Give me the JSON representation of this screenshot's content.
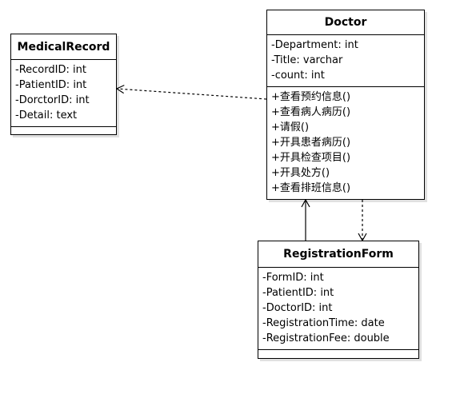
{
  "colors": {
    "line": "#000000",
    "background": "#ffffff"
  },
  "classes": {
    "medical_record": {
      "name": "MedicalRecord",
      "attributes": [
        "-RecordID: int",
        "-PatientID: int",
        "-DorctorID: int",
        "-Detail: text"
      ],
      "operations": []
    },
    "doctor": {
      "name": "Doctor",
      "attributes": [
        "-Department: int",
        "-Title: varchar",
        "-count: int"
      ],
      "operations": [
        "+查看预约信息()",
        "+查看病人病历()",
        "+请假()",
        "+开具患者病历()",
        "+开具检查项目()",
        "+开具处方()",
        "+查看排班信息()"
      ]
    },
    "registration_form": {
      "name": "RegistrationForm",
      "attributes": [
        "-FormID: int",
        "-PatientID: int",
        "-DoctorID: int",
        "-RegistrationTime: date",
        "-RegistrationFee: double"
      ],
      "operations": []
    }
  },
  "relationships": [
    {
      "from": "doctor",
      "to": "medical_record",
      "kind": "dependency",
      "line": "dashed",
      "arrow": "open"
    },
    {
      "from": "doctor",
      "to": "registration_form",
      "kind": "dependency",
      "line": "dashed",
      "arrow": "open"
    },
    {
      "from": "registration_form",
      "to": "doctor",
      "kind": "association",
      "line": "solid",
      "arrow": "open"
    }
  ]
}
